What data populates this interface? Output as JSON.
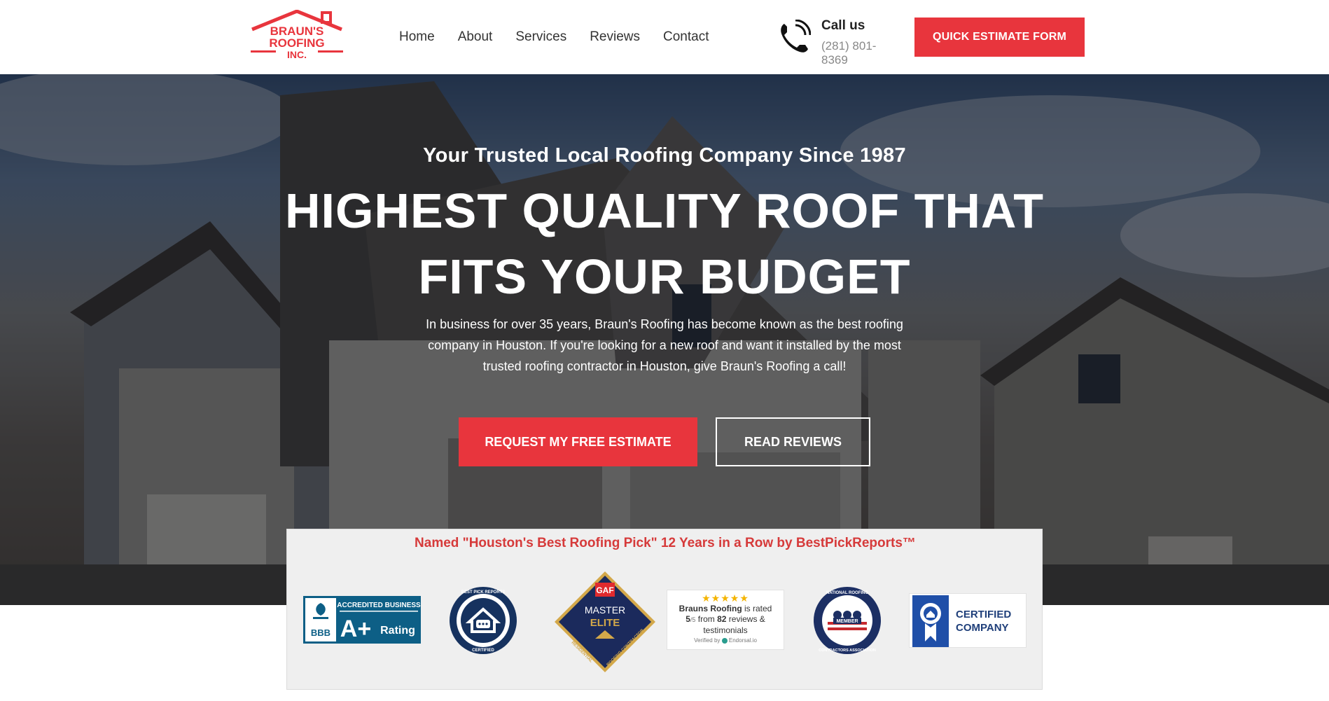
{
  "header": {
    "logo": {
      "line1": "BRAUN'S",
      "line2": "ROOFING",
      "line3": "INC."
    },
    "nav": [
      "Home",
      "About",
      "Services",
      "Reviews",
      "Contact"
    ],
    "call": {
      "title": "Call us",
      "number": "(281) 801-8369",
      "icon": "phone-icon"
    },
    "quick_estimate_label": "QUICK ESTIMATE FORM"
  },
  "hero": {
    "tagline": "Your Trusted Local Roofing Company Since 1987",
    "headline_line1": "HIGHEST QUALITY ROOF THAT",
    "headline_line2": "FITS YOUR BUDGET",
    "intro": "In business for over 35 years, Braun's Roofing has become known as the best roofing company in Houston. If you're looking for a new roof and want it installed by the most trusted roofing contractor in Houston, give Braun's Roofing a call!",
    "primary_button": "REQUEST MY FREE ESTIMATE",
    "secondary_button": "READ REVIEWS"
  },
  "awards": {
    "title": "Named \"Houston's Best Roofing Pick\" 12 Years in a Row by BestPickReports™",
    "bbb": {
      "top": "ACCREDITED BUSINESS",
      "grade": "A+",
      "rating": "Rating",
      "mark": "BBB"
    },
    "bestpick": {
      "ring": "BEST PICK REPORTS",
      "bottom": "CERTIFIED"
    },
    "gaf": {
      "brand": "GAF",
      "line1": "MASTER",
      "line2": "ELITE",
      "side_left": "RESIDENTIAL",
      "side_right": "ROOFING CONTRACTOR"
    },
    "endorsal": {
      "stars": "★★★★★",
      "line1_name": "Brauns Roofing",
      "line1_rest": " is rated",
      "line2_a": "5",
      "line2_b": "/5",
      "line2_c": " from ",
      "line2_d": "82",
      "line2_e": " reviews &",
      "line3": "testimonials",
      "verified": "Verified by",
      "verified_brand": "Endorsal.io"
    },
    "nrca": {
      "ring_top": "NATIONAL ROOFING",
      "ring_bottom": "CONTRACTORS ASSOCIATION",
      "member": "MEMBER"
    },
    "certified": {
      "line1": "CERTIFIED",
      "line2": "COMPANY"
    }
  },
  "colors": {
    "accent": "#e8353d",
    "award_title": "#d63a3a",
    "navy": "#1b3a6b"
  }
}
